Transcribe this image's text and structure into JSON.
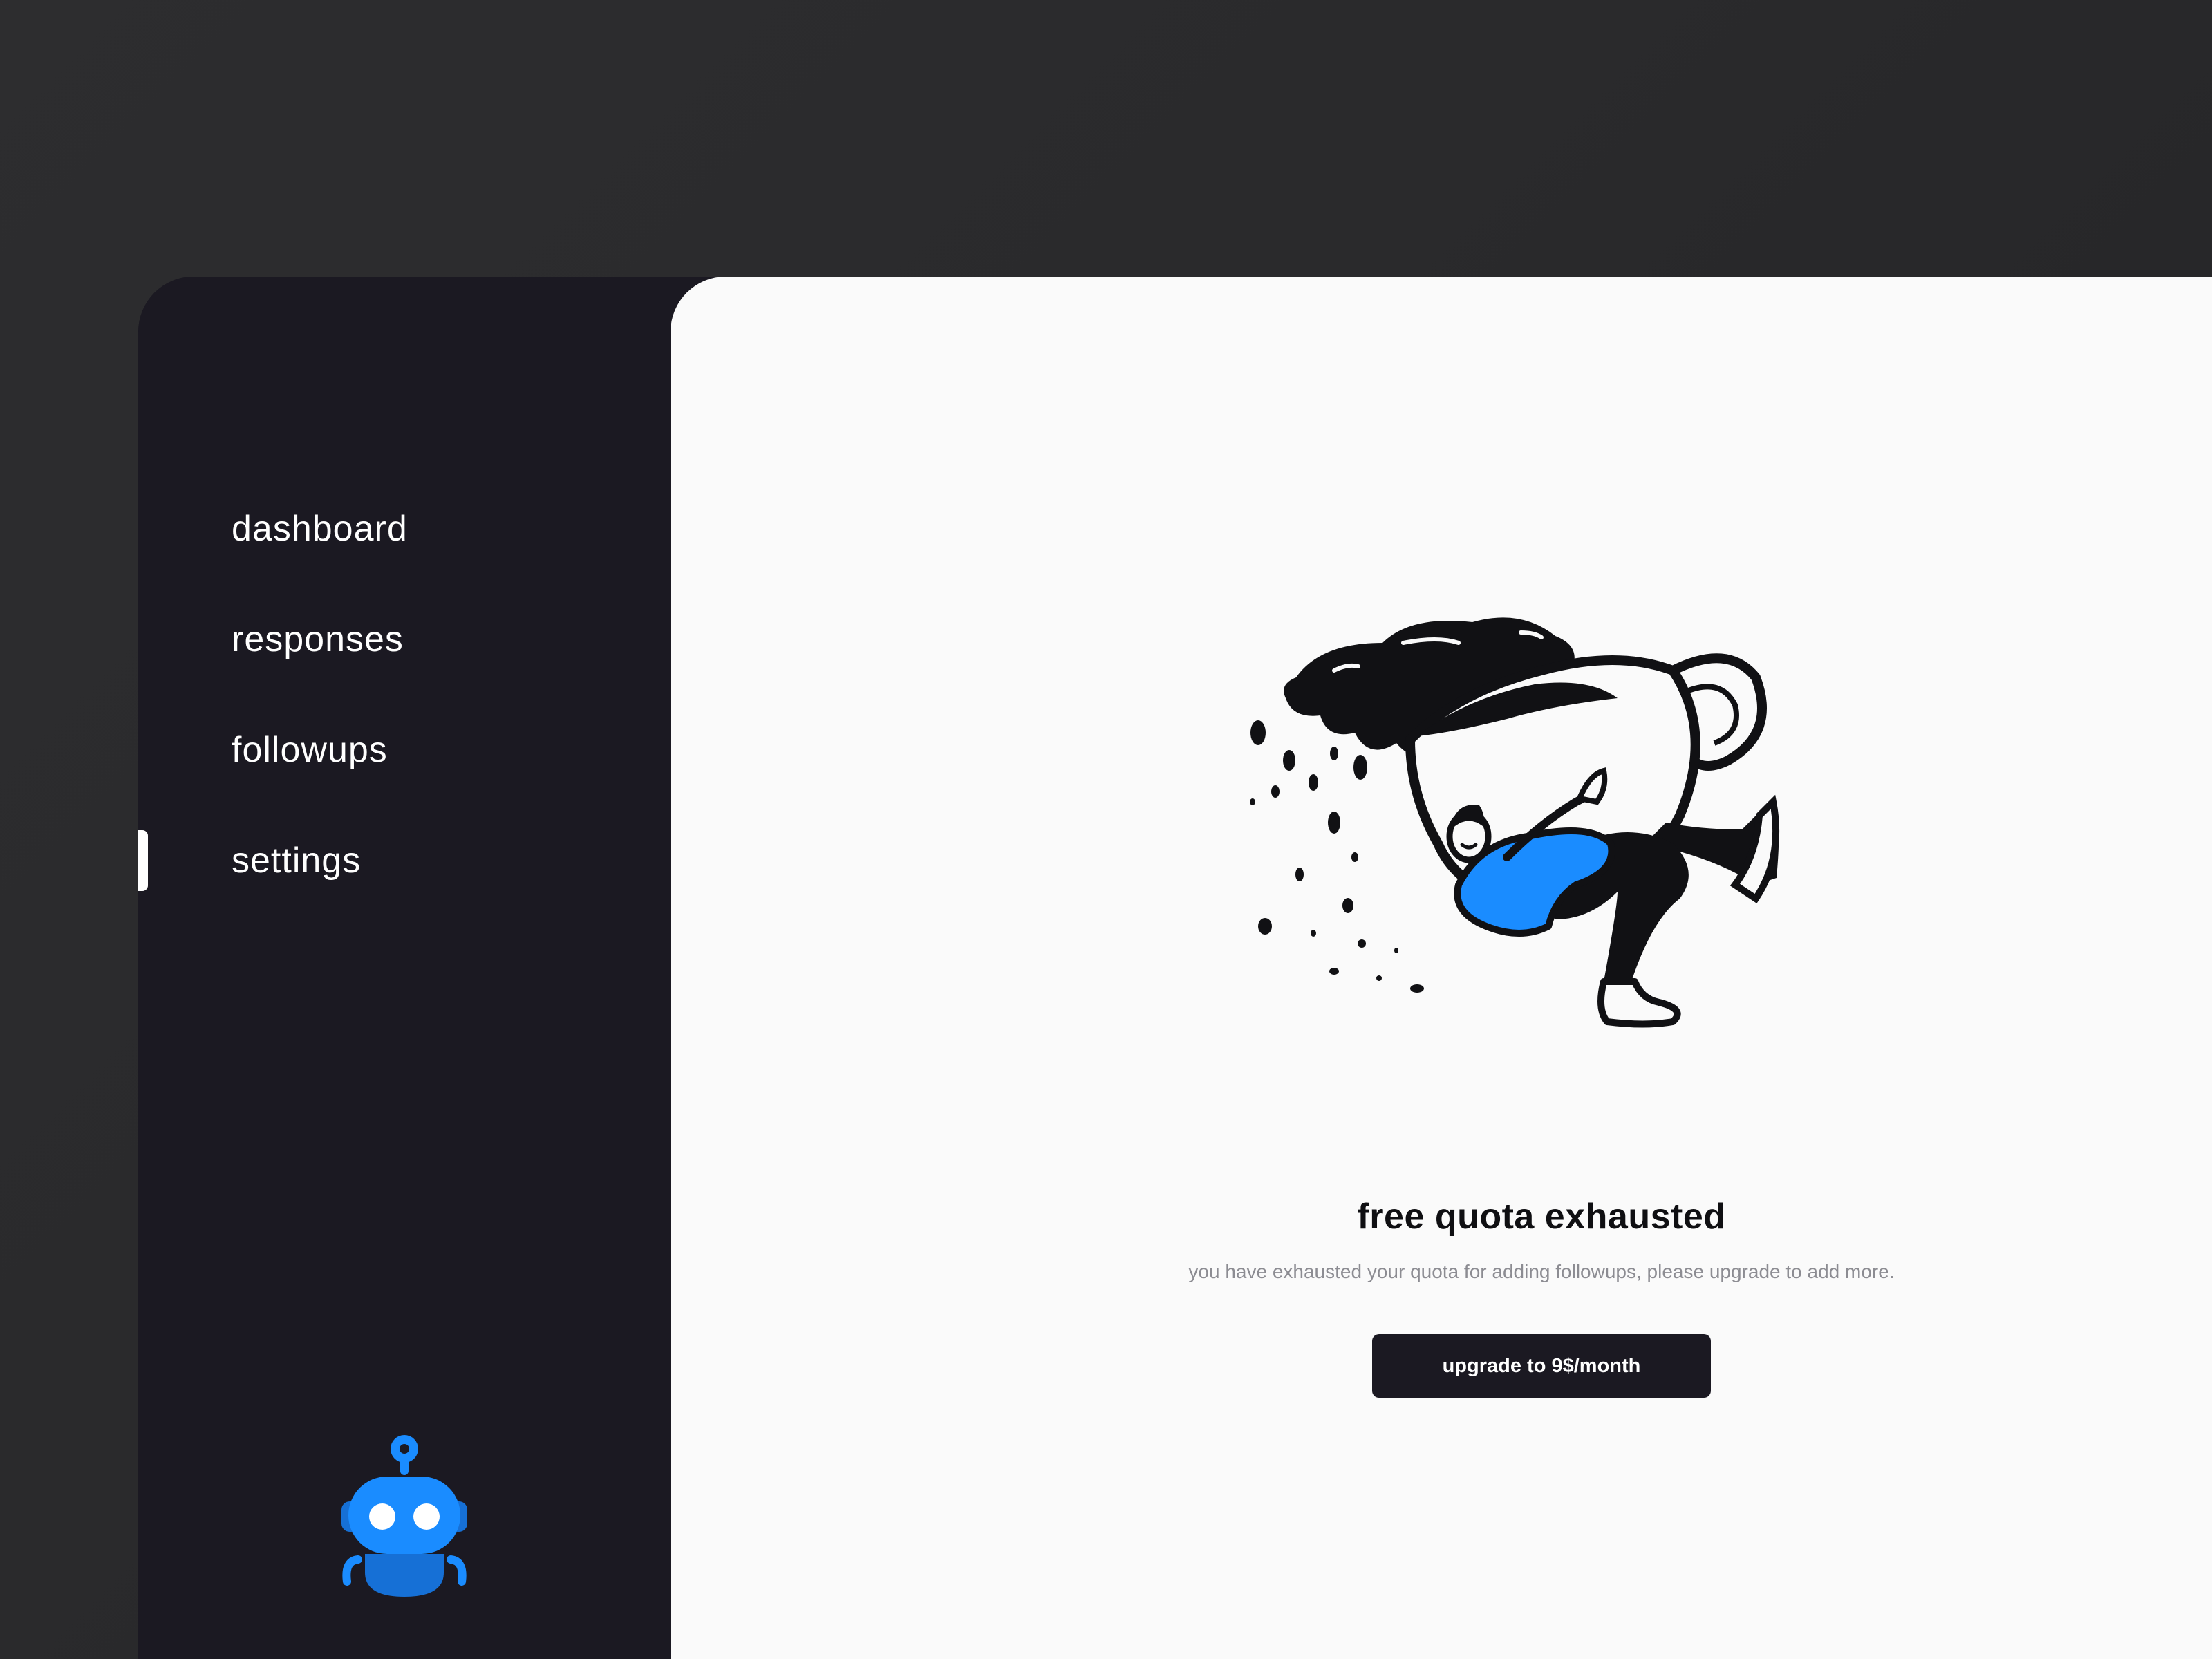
{
  "sidebar": {
    "items": [
      {
        "label": "dashboard",
        "active": false
      },
      {
        "label": "responses",
        "active": false
      },
      {
        "label": "followups",
        "active": false
      },
      {
        "label": "settings",
        "active": true
      }
    ],
    "logo_icon": "robot-icon"
  },
  "main": {
    "illustration_icon": "spilling-coffee-cup-illustration",
    "title": "free quota exhausted",
    "subtitle": "you have exhausted your quota for adding followups, please upgrade to add more.",
    "upgrade_button_label": "upgrade to 9$/month"
  },
  "colors": {
    "sidebar_bg": "#1b1922",
    "main_bg": "#fafafa",
    "accent_blue": "#1a8cff",
    "button_bg": "#1b1922"
  }
}
